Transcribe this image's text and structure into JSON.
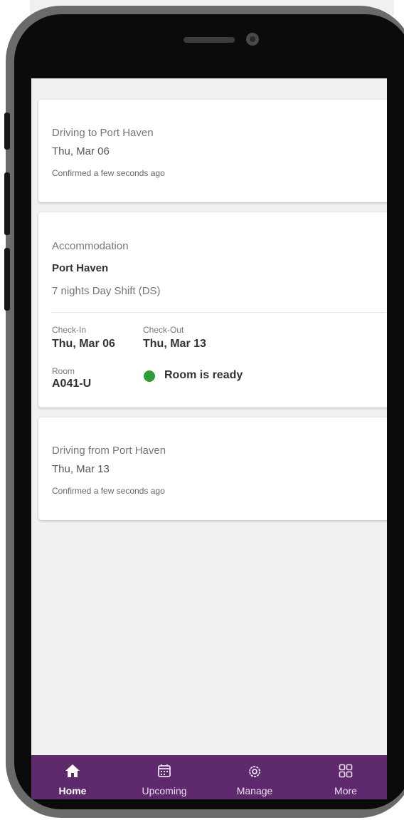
{
  "trip": {
    "outbound": {
      "title": "Driving to Port Haven",
      "date": "Thu, Mar 06",
      "status": "Confirmed a few seconds ago"
    },
    "accommodation": {
      "heading": "Accommodation",
      "location": "Port Haven",
      "stay": "7 nights Day Shift (DS)",
      "checkin_label": "Check-In",
      "checkin_value": "Thu, Mar 06",
      "checkout_label": "Check-Out",
      "checkout_value": "Thu, Mar 13",
      "room_label": "Room",
      "room_value": "A041-U",
      "room_status": "Room is ready",
      "room_status_color": "#2e9e3a"
    },
    "return": {
      "title": "Driving from Port Haven",
      "date": "Thu, Mar 13",
      "status": "Confirmed a few seconds ago"
    }
  },
  "nav": {
    "items": [
      {
        "label": "Home",
        "icon": "home-icon",
        "active": true
      },
      {
        "label": "Upcoming",
        "icon": "calendar-icon",
        "active": false
      },
      {
        "label": "Manage",
        "icon": "gear-icon",
        "active": false
      },
      {
        "label": "More",
        "icon": "grid-icon",
        "active": false
      }
    ],
    "background": "#5e2a6d"
  }
}
